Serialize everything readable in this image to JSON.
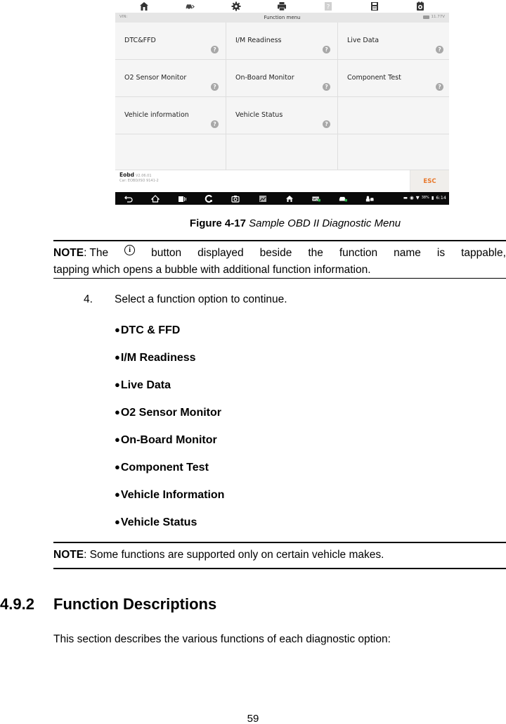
{
  "screenshot": {
    "toolbar_icons": [
      "home-icon",
      "vehicle-swap-icon",
      "gear-icon",
      "printer-icon",
      "help-icon",
      "save-icon",
      "data-logging-icon"
    ],
    "titlebar": {
      "vin_label": "VIN:",
      "title": "Function menu",
      "voltage": "11.77V"
    },
    "functions": [
      {
        "label": "DTC&FFD",
        "help": "?"
      },
      {
        "label": "I/M Readiness",
        "help": "?"
      },
      {
        "label": "Live Data",
        "help": "?"
      },
      {
        "label": "O2 Sensor Monitor",
        "help": "?"
      },
      {
        "label": "On-Board Monitor",
        "help": "?"
      },
      {
        "label": "Component Test",
        "help": "?"
      },
      {
        "label": "Vehicle information",
        "help": "?"
      },
      {
        "label": "Vehicle Status",
        "help": "?"
      },
      {
        "label": "",
        "help": ""
      },
      {
        "label": "",
        "help": ""
      },
      {
        "label": "",
        "help": ""
      },
      {
        "label": "",
        "help": ""
      }
    ],
    "footer": {
      "app_name": "Eobd",
      "version": "V2.06.01",
      "car": "Car: EOBD/ISO 9141-2",
      "esc_label": "ESC",
      "esc_color": "#e8782b"
    },
    "navbar": {
      "icons": [
        "back-icon",
        "home-icon",
        "recent-apps-icon",
        "browser-icon",
        "camera-icon",
        "screenshot-icon",
        "maxisys-home-icon",
        "vci-icon",
        "vehicle-icon",
        "remote-icon"
      ],
      "battery": "38%",
      "time": "6:14"
    }
  },
  "caption": {
    "label": "Figure 4-17",
    "text": "Sample OBD II Diagnostic Menu"
  },
  "note1": {
    "label": "NOTE",
    "words_before": ": The",
    "info_glyph": "i",
    "words_after": [
      "button",
      "displayed",
      "beside",
      "the",
      "function",
      "name",
      "is",
      "tappable,"
    ],
    "line2": "tapping which opens a bubble with additional function information."
  },
  "step": {
    "number": "4.",
    "text": "Select a function option to continue."
  },
  "bullets": [
    "DTC & FFD",
    "I/M Readiness",
    "Live Data",
    "O2 Sensor Monitor",
    "On-Board Monitor",
    "Component Test",
    "Vehicle Information",
    "Vehicle Status"
  ],
  "note2": {
    "label": "NOTE",
    "text": ": Some functions are supported only on certain vehicle makes."
  },
  "section": {
    "number": "4.9.2",
    "title": "Function Descriptions"
  },
  "paragraph": "This section describes the various functions of each diagnostic option:",
  "page_number": "59"
}
